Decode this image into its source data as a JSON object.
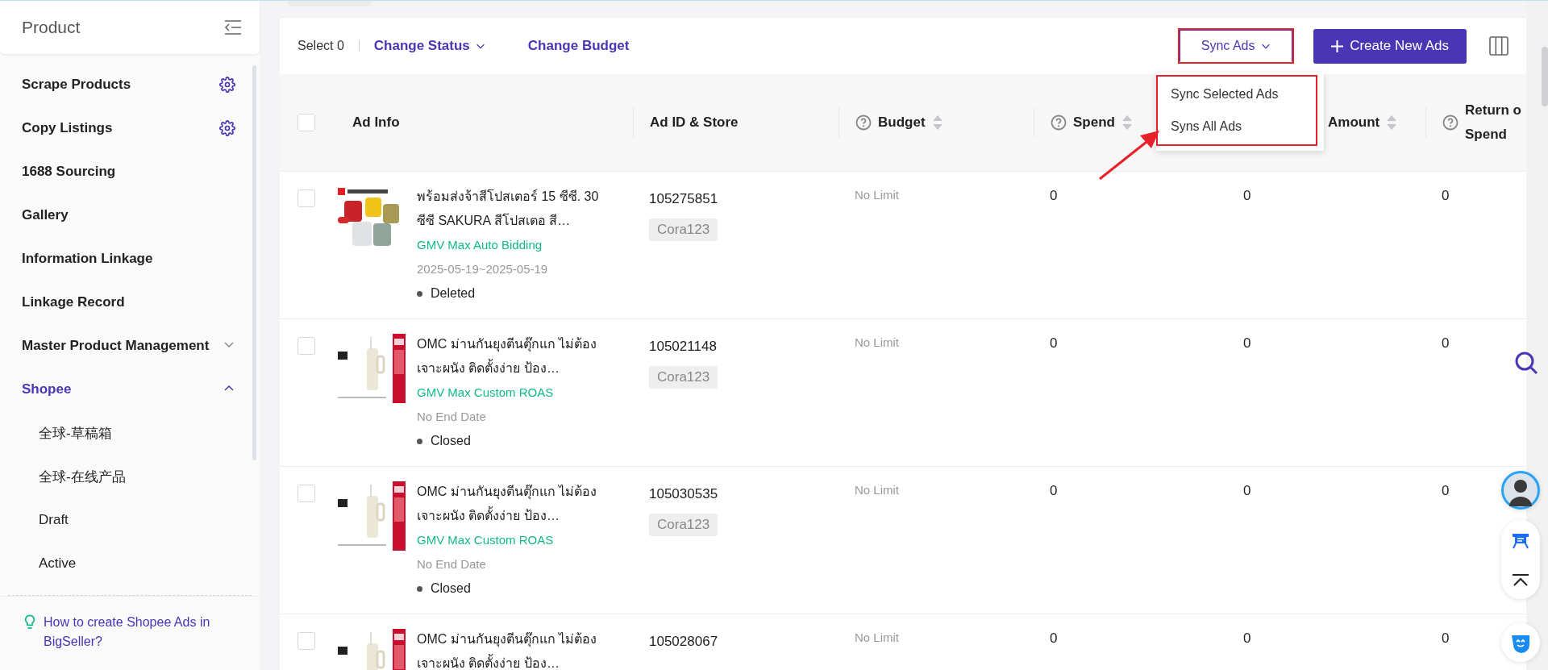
{
  "sidebar": {
    "title": "Product",
    "items": [
      {
        "label": "Scrape Products",
        "kind": "settings",
        "selected": false
      },
      {
        "label": "Copy Listings",
        "kind": "settings",
        "selected": false
      },
      {
        "label": "1688 Sourcing",
        "kind": "plain",
        "selected": false
      },
      {
        "label": "Gallery",
        "kind": "plain",
        "selected": false
      },
      {
        "label": "Information Linkage",
        "kind": "plain",
        "selected": false
      },
      {
        "label": "Linkage Record",
        "kind": "plain",
        "selected": false
      },
      {
        "label": "Master Product Management",
        "kind": "group",
        "selected": false,
        "expanded": false
      },
      {
        "label": "Shopee",
        "kind": "group",
        "selected": true,
        "expanded": true,
        "children": [
          {
            "label": "全球-草稿箱",
            "selected": false
          },
          {
            "label": "全球-在线产品",
            "selected": false
          },
          {
            "label": "Draft",
            "selected": false
          },
          {
            "label": "Active",
            "selected": false
          }
        ]
      }
    ],
    "help_link": "How to create Shopee Ads in BigSeller?"
  },
  "toolbar": {
    "select_label": "Select 0",
    "change_status": "Change Status",
    "change_budget": "Change Budget",
    "sync_ads": {
      "label": "Sync Ads",
      "expanded": true,
      "options": [
        "Sync Selected Ads",
        "Syns All Ads"
      ]
    },
    "create_button": "Create New Ads"
  },
  "table": {
    "all_checked": false,
    "columns": [
      {
        "label": "Ad Info",
        "help": false,
        "sortable": false
      },
      {
        "label": "Ad ID & Store",
        "help": false,
        "sortable": false
      },
      {
        "label": "Budget",
        "help": true,
        "sortable": true
      },
      {
        "label": "Spend",
        "help": true,
        "sortable": true
      },
      {
        "label": "Amount",
        "help": false,
        "sortable": true
      },
      {
        "label": "Return o",
        "label_line_2": "Spend",
        "help": true,
        "sortable": false
      }
    ],
    "rows": [
      {
        "checked": false,
        "title": "พร้อมส่งจ้าสีโปสเตอร์ 15 ซีซี. 30 ซีซี SAKURA สีโปสเตอ สี…",
        "bidding": "GMV Max Auto Bidding",
        "date": "2025-05-19~2025-05-19",
        "status": "Deleted",
        "ad_id": "105275851",
        "store": "Cora123",
        "budget": "No Limit",
        "spend": "0",
        "amount": "0",
        "return": "0"
      },
      {
        "checked": false,
        "title": "OMC ม่านกันยุงตีนตุ๊กแก ไม่ต้องเจาะผนัง ติดตั้งง่าย ป้อง…",
        "bidding": "GMV Max Custom ROAS",
        "date": "No End Date",
        "status": "Closed",
        "ad_id": "105021148",
        "store": "Cora123",
        "budget": "No Limit",
        "spend": "0",
        "amount": "0",
        "return": "0"
      },
      {
        "checked": false,
        "title": "OMC ม่านกันยุงตีนตุ๊กแก ไม่ต้องเจาะผนัง ติดตั้งง่าย ป้อง…",
        "bidding": "GMV Max Custom ROAS",
        "date": "No End Date",
        "status": "Closed",
        "ad_id": "105030535",
        "store": "Cora123",
        "budget": "No Limit",
        "spend": "0",
        "amount": "0",
        "return": "0"
      },
      {
        "checked": false,
        "title": "OMC ม่านกันยุงตีนตุ๊กแก ไม่ต้องเจาะผนัง ติดตั้งง่าย ป้อง…",
        "ad_id": "105028067",
        "budget": "No Limit",
        "spend": "0",
        "amount": "0",
        "return": "0"
      }
    ]
  }
}
